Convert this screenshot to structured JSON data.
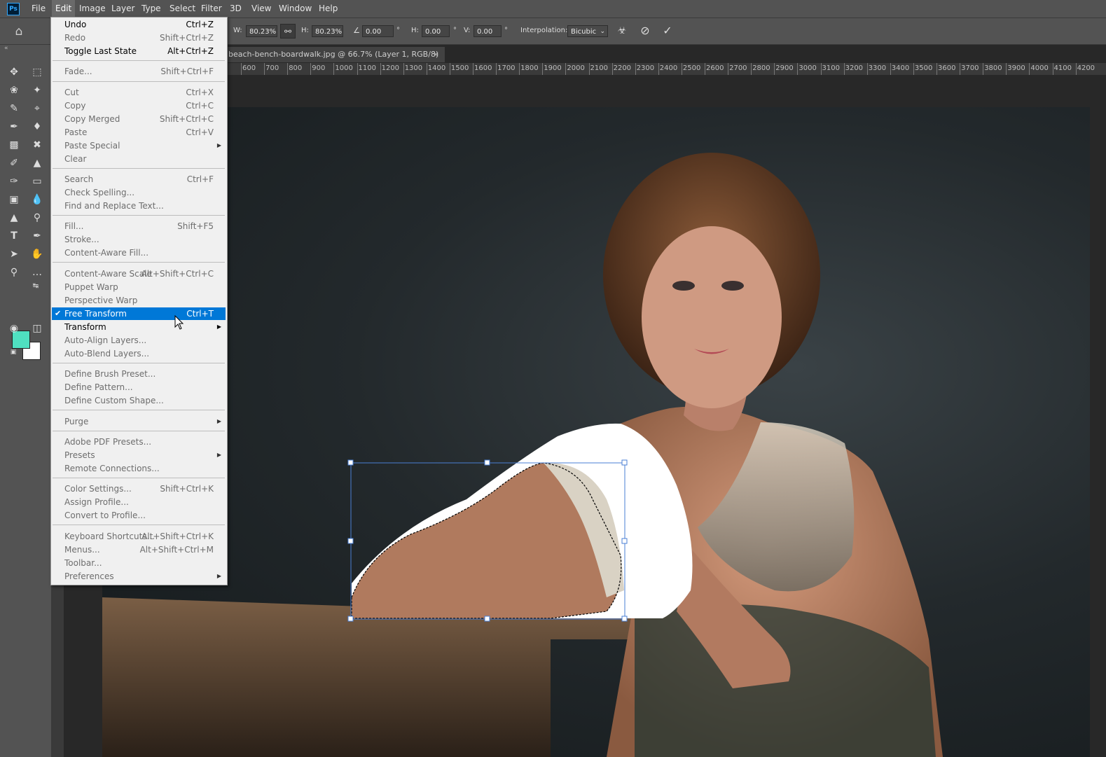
{
  "app": {
    "logo": "Ps"
  },
  "menubar": {
    "items": [
      "File",
      "Edit",
      "Image",
      "Layer",
      "Type",
      "Select",
      "Filter",
      "3D",
      "View",
      "Window",
      "Help"
    ],
    "active": "Edit"
  },
  "options": {
    "w_label": "W:",
    "w_value": "80.23%",
    "h_label": "H:",
    "h_value": "80.23%",
    "angle_value": "0.00",
    "hskew_label": "H:",
    "hskew_value": "0.00",
    "vskew_label": "V:",
    "vskew_value": "0.00",
    "degree": "°",
    "interp_label": "Interpolation:",
    "interp_value": "Bicubic"
  },
  "document": {
    "tab_title": "beach-bench-boardwalk.jpg @ 66.7% (Layer 1, RGB/8) *",
    "tab_close": "×"
  },
  "ruler": {
    "ticks": [
      "600",
      "700",
      "800",
      "900",
      "1000",
      "1100",
      "1200",
      "1300",
      "1400",
      "1500",
      "1600",
      "1700",
      "1800",
      "1900",
      "2000",
      "2100",
      "2200",
      "2300",
      "2400",
      "2500",
      "2600",
      "2700",
      "2800",
      "2900",
      "3000",
      "3100",
      "3200",
      "3300",
      "3400",
      "3500",
      "3600",
      "3700",
      "3800",
      "3900",
      "4000",
      "4100",
      "4200"
    ]
  },
  "colors": {
    "foreground": "#4fe0c0",
    "background": "#ffffff",
    "accent": "#0078d7",
    "transform_box": "#4a7fd4"
  },
  "edit_menu": {
    "undo": {
      "label": "Undo",
      "shortcut": "Ctrl+Z"
    },
    "redo": {
      "label": "Redo",
      "shortcut": "Shift+Ctrl+Z"
    },
    "toggle_last_state": {
      "label": "Toggle Last State",
      "shortcut": "Alt+Ctrl+Z"
    },
    "fade": {
      "label": "Fade...",
      "shortcut": "Shift+Ctrl+F"
    },
    "cut": {
      "label": "Cut",
      "shortcut": "Ctrl+X"
    },
    "copy": {
      "label": "Copy",
      "shortcut": "Ctrl+C"
    },
    "copy_merged": {
      "label": "Copy Merged",
      "shortcut": "Shift+Ctrl+C"
    },
    "paste": {
      "label": "Paste",
      "shortcut": "Ctrl+V"
    },
    "paste_special": {
      "label": "Paste Special"
    },
    "clear": {
      "label": "Clear"
    },
    "search": {
      "label": "Search",
      "shortcut": "Ctrl+F"
    },
    "check_spelling": {
      "label": "Check Spelling..."
    },
    "find_replace": {
      "label": "Find and Replace Text..."
    },
    "fill": {
      "label": "Fill...",
      "shortcut": "Shift+F5"
    },
    "stroke": {
      "label": "Stroke..."
    },
    "content_aware_fill": {
      "label": "Content-Aware Fill..."
    },
    "content_aware_scale": {
      "label": "Content-Aware Scale",
      "shortcut": "Alt+Shift+Ctrl+C"
    },
    "puppet_warp": {
      "label": "Puppet Warp"
    },
    "perspective_warp": {
      "label": "Perspective Warp"
    },
    "free_transform": {
      "label": "Free Transform",
      "shortcut": "Ctrl+T"
    },
    "transform": {
      "label": "Transform"
    },
    "auto_align": {
      "label": "Auto-Align Layers..."
    },
    "auto_blend": {
      "label": "Auto-Blend Layers..."
    },
    "define_brush": {
      "label": "Define Brush Preset..."
    },
    "define_pattern": {
      "label": "Define Pattern..."
    },
    "define_shape": {
      "label": "Define Custom Shape..."
    },
    "purge": {
      "label": "Purge"
    },
    "pdf_presets": {
      "label": "Adobe PDF Presets..."
    },
    "presets": {
      "label": "Presets"
    },
    "remote_connections": {
      "label": "Remote Connections..."
    },
    "color_settings": {
      "label": "Color Settings...",
      "shortcut": "Shift+Ctrl+K"
    },
    "assign_profile": {
      "label": "Assign Profile..."
    },
    "convert_profile": {
      "label": "Convert to Profile..."
    },
    "keyboard_shortcuts": {
      "label": "Keyboard Shortcuts...",
      "shortcut": "Alt+Shift+Ctrl+K"
    },
    "menus": {
      "label": "Menus...",
      "shortcut": "Alt+Shift+Ctrl+M"
    },
    "toolbar": {
      "label": "Toolbar..."
    },
    "preferences": {
      "label": "Preferences"
    }
  }
}
